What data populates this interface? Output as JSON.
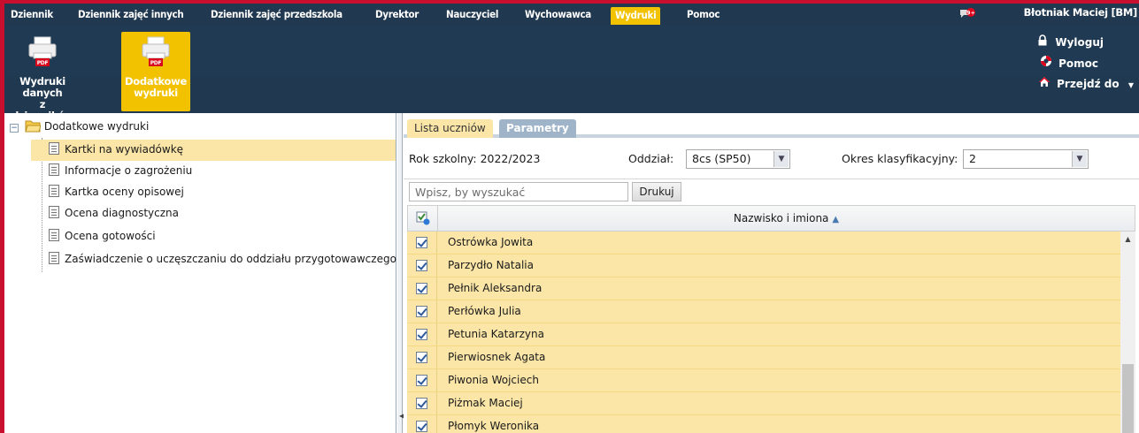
{
  "menu": {
    "items": [
      {
        "label": "Dziennik"
      },
      {
        "label": "Dziennik zajęć innych"
      },
      {
        "label": "Dziennik zajęć przedszkola"
      },
      {
        "label": "Dyrektor"
      },
      {
        "label": "Nauczyciel"
      },
      {
        "label": "Wychowawca"
      },
      {
        "label": "Wydruki",
        "active": true
      },
      {
        "label": "Pomoc"
      }
    ],
    "notification_badge": "9+",
    "user_name": "Błotniak Maciej [BM]"
  },
  "ribbon": {
    "buttons": [
      {
        "label_line1": "Wydruki danych",
        "label_line2": "z dzienników",
        "icon_text": "PDF"
      },
      {
        "label_line1": "Dodatkowe",
        "label_line2": "wydruki",
        "icon_text": "PDF",
        "active": true
      }
    ],
    "right_links": [
      {
        "label": "Wyloguj",
        "icon": "lock-icon"
      },
      {
        "label": "Pomoc",
        "icon": "lifebuoy-icon"
      },
      {
        "label": "Przejdź do",
        "icon": "home-icon"
      }
    ]
  },
  "tree": {
    "root": "Dodatkowe wydruki",
    "items": [
      {
        "label": "Kartki na wywiadówkę",
        "selected": true
      },
      {
        "label": "Informacje o zagrożeniu"
      },
      {
        "label": "Kartka oceny opisowej"
      },
      {
        "label": "Ocena diagnostyczna"
      },
      {
        "label": "Ocena gotowości"
      },
      {
        "label": "Zaświadczenie o uczęszczaniu do oddziału przygotowawczego"
      }
    ]
  },
  "tabs": {
    "list": "Lista uczniów",
    "params": "Parametry"
  },
  "params": {
    "school_year": "Rok szkolny: 2022/2023",
    "class_label": "Oddział:",
    "class_value": "8cs (SP50)",
    "period_label": "Okres klasyfikacyjny:",
    "period_value": "2"
  },
  "search": {
    "placeholder": "Wpisz, by wyszukać",
    "print_label": "Drukuj"
  },
  "grid": {
    "column_header": "Nazwisko i imiona",
    "rows": [
      "Ostrówka Jowita",
      "Parzydło Natalia",
      "Pełnik Aleksandra",
      "Perłówka Julia",
      "Petunia Katarzyna",
      "Pierwiosnek Agata",
      "Piwonia Wojciech",
      "Piżmak Maciej",
      "Płomyk Weronika"
    ]
  },
  "colors": {
    "menu_bg": "#203850",
    "accent_yellow": "#f2c200",
    "row_highlight": "#fbe6a8",
    "frame_red": "#c8102e"
  }
}
